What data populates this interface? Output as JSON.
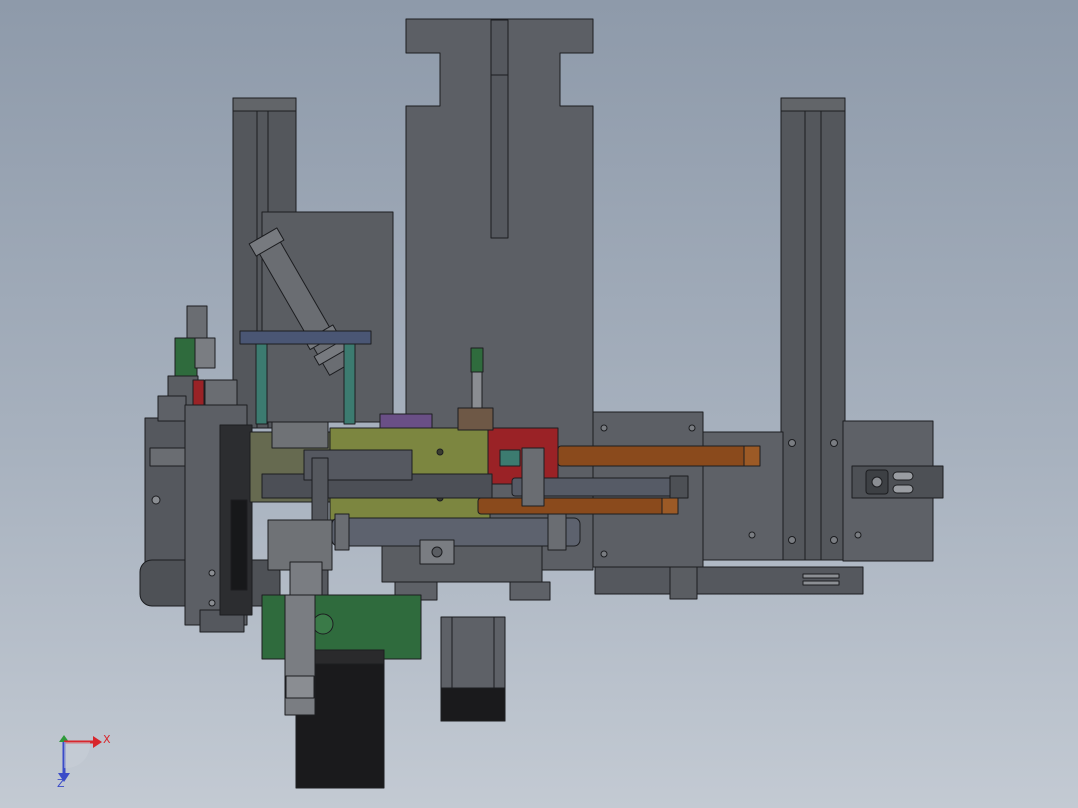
{
  "viewport": {
    "background_top": "#8e9aaa",
    "background_bottom": "#c3cad3"
  },
  "model": {
    "colors": {
      "body": "#5c5f65",
      "body_light": "#6b6e74",
      "edge": "#1c1d20",
      "rail": "#54575c",
      "green": "#2f6b3d",
      "olive": "#7c8640",
      "red": "#9a2226",
      "copper": "#8a4a1c",
      "steel": "#565b66",
      "teal": "#3c7b70",
      "purple": "#6a4f86",
      "blue_plate": "#3f4d6e",
      "motor_black": "#1a1a1c"
    }
  },
  "triad": {
    "x_label": "X",
    "z_label": "Z",
    "x_color": "#d8262c",
    "y_color": "#2e9a3a",
    "z_color": "#3a4bc8"
  }
}
